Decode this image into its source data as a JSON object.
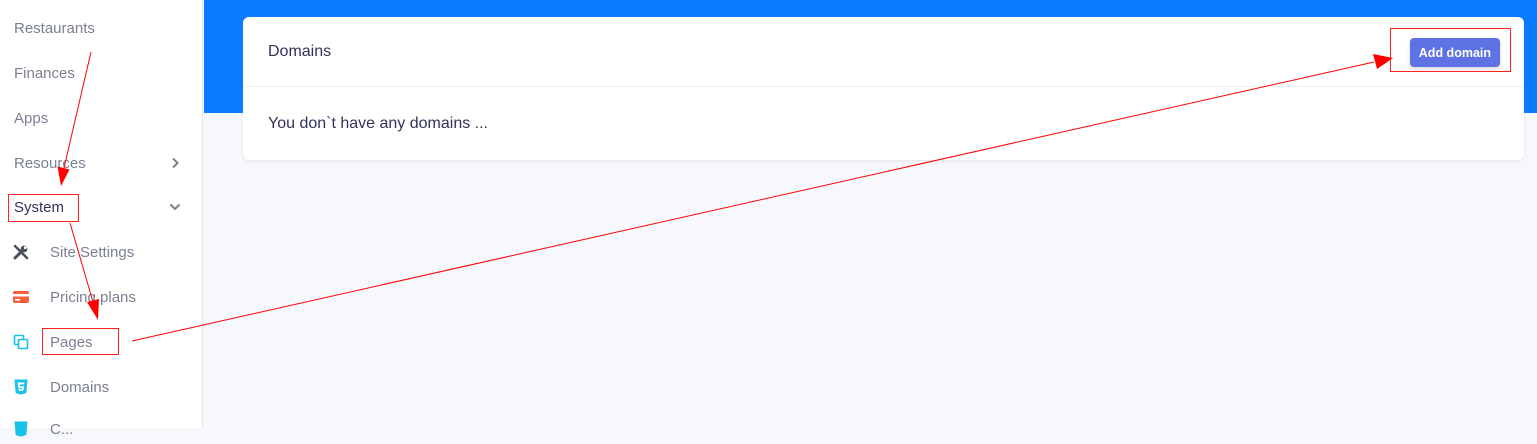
{
  "sidebar": {
    "items": [
      {
        "label": "Restaurants"
      },
      {
        "label": "Finances"
      },
      {
        "label": "Apps"
      },
      {
        "label": "Resources"
      },
      {
        "label": "System"
      }
    ],
    "system_children": [
      {
        "label": "Site Settings",
        "icon": "tools-icon"
      },
      {
        "label": "Pricing plans",
        "icon": "credit-card-icon"
      },
      {
        "label": "Pages",
        "icon": "copy-icon"
      },
      {
        "label": "Domains",
        "icon": "html5-icon"
      },
      {
        "label": "C...",
        "icon": "css3-icon"
      }
    ]
  },
  "card": {
    "title": "Domains",
    "add_button": "Add domain",
    "empty_message": "You don`t have any domains ..."
  },
  "colors": {
    "topbar": "#0a7cff",
    "button": "#5e72e4",
    "annotation": "#ff0000",
    "pricing_icon": "#f5603d",
    "cyan_icons": "#17c1e8"
  }
}
